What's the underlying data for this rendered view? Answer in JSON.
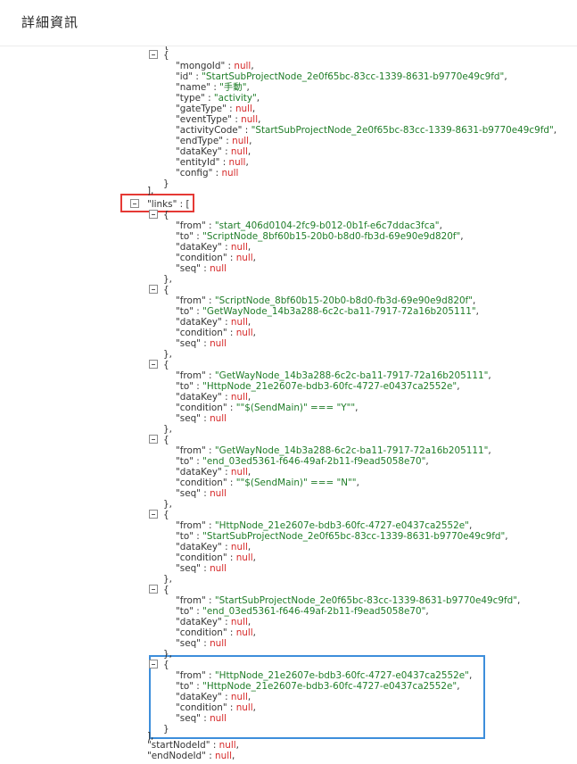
{
  "header": {
    "title": "詳細資訊"
  },
  "node": {
    "lines": [
      {
        "key": "mongoId",
        "val": "null",
        "type": "null"
      },
      {
        "key": "id",
        "val": "StartSubProjectNode_2e0f65bc-83cc-1339-8631-b9770e49c9fd",
        "type": "str"
      },
      {
        "key": "name",
        "val": "手動",
        "type": "str"
      },
      {
        "key": "type",
        "val": "activity",
        "type": "str"
      },
      {
        "key": "gateType",
        "val": "null",
        "type": "null"
      },
      {
        "key": "eventType",
        "val": "null",
        "type": "null"
      },
      {
        "key": "activityCode",
        "val": "StartSubProjectNode_2e0f65bc-83cc-1339-8631-b9770e49c9fd",
        "type": "str"
      },
      {
        "key": "endType",
        "val": "null",
        "type": "null"
      },
      {
        "key": "dataKey",
        "val": "null",
        "type": "null"
      },
      {
        "key": "entityId",
        "val": "null",
        "type": "null"
      },
      {
        "key": "config",
        "val": "null",
        "type": "null"
      }
    ]
  },
  "links_label": "links",
  "links": [
    {
      "from": "start_406d0104-2fc9-b012-0b1f-e6c7ddac3fca",
      "to": "ScriptNode_8bf60b15-20b0-b8d0-fb3d-69e90e9d820f",
      "dataKey": "null",
      "condition": "null",
      "seq": "null"
    },
    {
      "from": "ScriptNode_8bf60b15-20b0-b8d0-fb3d-69e90e9d820f",
      "to": "GetWayNode_14b3a288-6c2c-ba11-7917-72a16b205111",
      "dataKey": "null",
      "condition": "null",
      "seq": "null"
    },
    {
      "from": "GetWayNode_14b3a288-6c2c-ba11-7917-72a16b205111",
      "to": "HttpNode_21e2607e-bdb3-60fc-4727-e0437ca2552e",
      "dataKey": "null",
      "condition": "\"$(SendMain)\" === \"Y\"",
      "seq": "null"
    },
    {
      "from": "GetWayNode_14b3a288-6c2c-ba11-7917-72a16b205111",
      "to": "end_03ed5361-f646-49af-2b11-f9ead5058e70",
      "dataKey": "null",
      "condition": "\"$(SendMain)\" === \"N\"",
      "seq": "null"
    },
    {
      "from": "HttpNode_21e2607e-bdb3-60fc-4727-e0437ca2552e",
      "to": "StartSubProjectNode_2e0f65bc-83cc-1339-8631-b9770e49c9fd",
      "dataKey": "null",
      "condition": "null",
      "seq": "null"
    },
    {
      "from": "StartSubProjectNode_2e0f65bc-83cc-1339-8631-b9770e49c9fd",
      "to": "end_03ed5361-f646-49af-2b11-f9ead5058e70",
      "dataKey": "null",
      "condition": "null",
      "seq": "null"
    },
    {
      "from": "HttpNode_21e2607e-bdb3-60fc-4727-e0437ca2552e",
      "to": "HttpNode_21e2607e-bdb3-60fc-4727-e0437ca2552e",
      "dataKey": "null",
      "condition": "null",
      "seq": "null"
    }
  ],
  "tail": [
    {
      "key": "startNodeId",
      "val": "null"
    },
    {
      "key": "endNodeId",
      "val": "null"
    }
  ]
}
